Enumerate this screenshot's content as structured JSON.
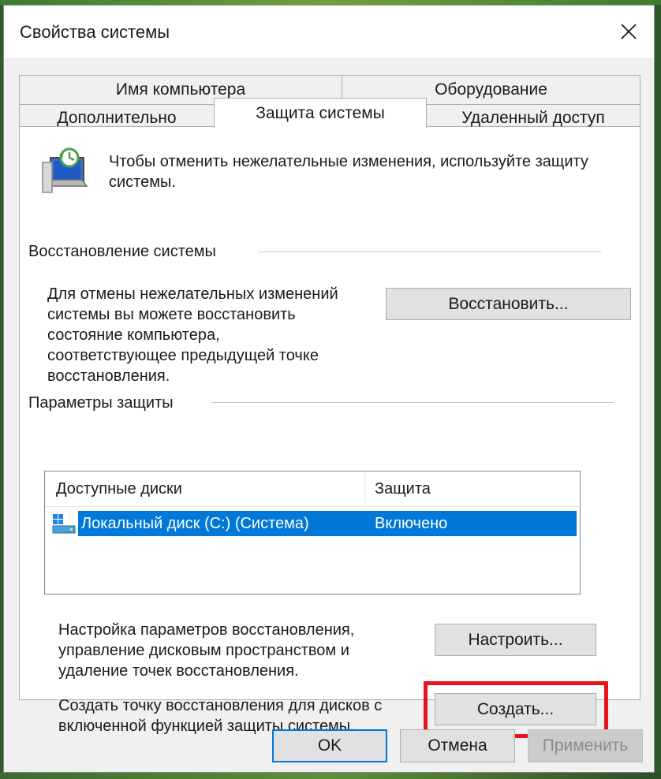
{
  "window": {
    "title": "Свойства системы"
  },
  "tabs": [
    {
      "label": "Имя компьютера"
    },
    {
      "label": "Оборудование"
    },
    {
      "label": "Дополнительно"
    },
    {
      "label": "Защита системы"
    },
    {
      "label": "Удаленный доступ"
    }
  ],
  "intro": {
    "text": "Чтобы отменить нежелательные изменения, используйте защиту системы."
  },
  "restore": {
    "heading": "Восстановление системы",
    "description_lines": [
      "Для отмены нежелательных изменений",
      "системы вы можете восстановить",
      "состояние компьютера,",
      "соответствующее предыдущей точке",
      "восстановления."
    ],
    "button_label": "Восстановить..."
  },
  "protection": {
    "heading": "Параметры защиты",
    "columns": [
      "Доступные диски",
      "Защита"
    ],
    "rows": [
      {
        "drive": "Локальный диск (C:) (Система)",
        "status": "Включено",
        "selected": true
      }
    ]
  },
  "configure": {
    "description_lines": [
      "Настройка параметров восстановления,",
      "управление дисковым пространством и",
      "удаление точек восстановления."
    ],
    "button_label": "Настроить..."
  },
  "create": {
    "description_lines": [
      "Создать точку восстановления для дисков с",
      "включенной функцией защиты системы."
    ],
    "button_label": "Создать..."
  },
  "footer": {
    "ok_label": "OK",
    "cancel_label": "Отмена",
    "apply_label": "Применить"
  },
  "colors": {
    "accent": "#0078d7",
    "highlight": "#e8141a",
    "selection": "#0078d7"
  },
  "icons": {
    "close": "close-icon",
    "system_protection": "system-protection-icon",
    "drive": "drive-icon"
  }
}
